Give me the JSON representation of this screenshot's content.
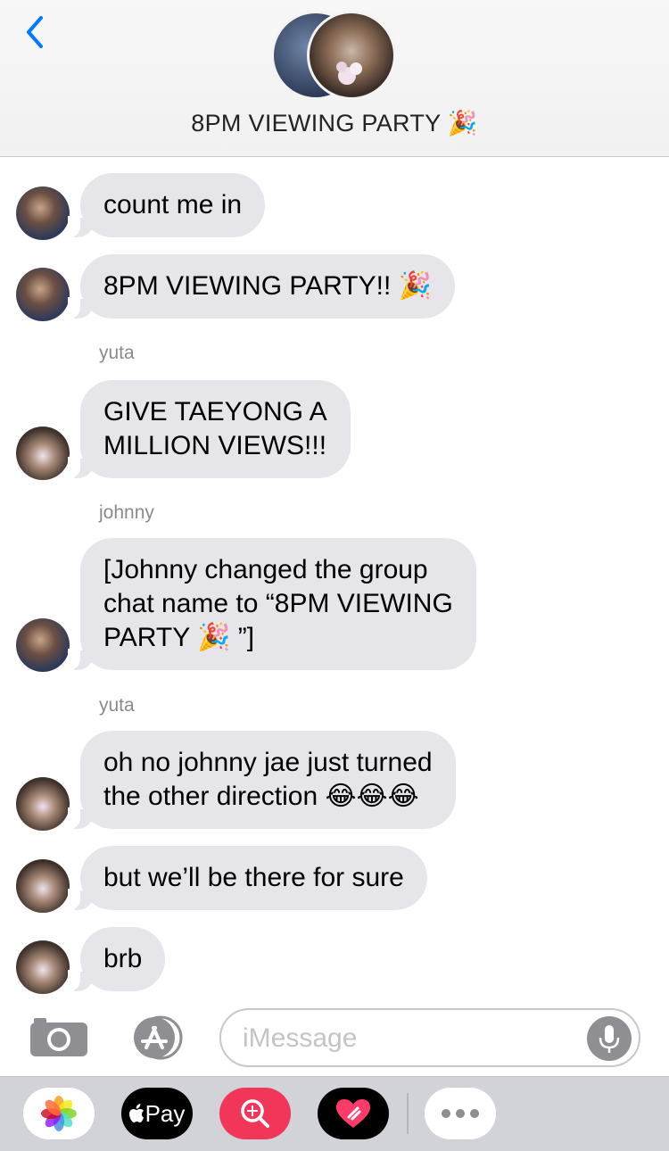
{
  "header": {
    "title": "8PM VIEWING PARTY 🎉",
    "back_icon": "chevron-left-icon",
    "accent_color": "#007aff"
  },
  "messages": [
    {
      "type": "bubble",
      "author": "taeyong",
      "text": "count me in"
    },
    {
      "type": "bubble",
      "author": "taeyong",
      "text": "8PM VIEWING PARTY!! 🎉"
    },
    {
      "type": "sender",
      "text": "yuta"
    },
    {
      "type": "bubble",
      "author": "yuta",
      "text": "GIVE TAEYONG A\nMILLION VIEWS!!!"
    },
    {
      "type": "sender",
      "text": "johnny"
    },
    {
      "type": "bubble",
      "author": "taeyong",
      "text": "[Johnny changed the group\nchat name to “8PM VIEWING\nPARTY 🎉 ”]"
    },
    {
      "type": "sender",
      "text": "yuta"
    },
    {
      "type": "bubble",
      "author": "yuta",
      "text": "oh no johnny jae just turned\nthe other direction 😂😂😂"
    },
    {
      "type": "bubble",
      "author": "yuta",
      "text": "but we’ll be there for sure"
    },
    {
      "type": "bubble",
      "author": "yuta",
      "text": "brb"
    }
  ],
  "composer": {
    "placeholder": "iMessage",
    "camera_icon": "camera-icon",
    "apps_icon": "app-store-icon",
    "mic_icon": "microphone-icon"
  },
  "app_drawer": {
    "apps": [
      {
        "icon": "photos-icon"
      },
      {
        "icon": "apple-pay-icon",
        "label": "Pay"
      },
      {
        "icon": "images-search-icon"
      },
      {
        "icon": "digital-touch-icon"
      },
      {
        "icon": "more-icon"
      }
    ],
    "pay_brand_color": "#000000",
    "search_color": "#f2365a"
  },
  "colors": {
    "bubble_gray": "#e5e5ea",
    "sender_gray": "#8a8a8e"
  }
}
